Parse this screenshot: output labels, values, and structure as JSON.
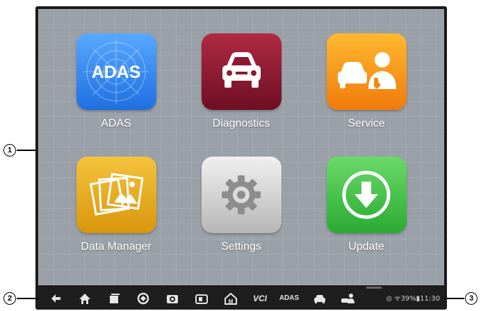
{
  "apps": [
    {
      "label": "ADAS",
      "icon": "adas-icon",
      "color_top": "#57a9ff",
      "color_bottom": "#1f6fe0",
      "badge": "ADAS"
    },
    {
      "label": "Diagnostics",
      "icon": "car-icon",
      "color_top": "#b12a43",
      "color_bottom": "#6d0f22"
    },
    {
      "label": "Service",
      "icon": "service-technician-icon",
      "color_top": "#ffb92f",
      "color_bottom": "#f07a0b"
    },
    {
      "label": "Data Manager",
      "icon": "photo-folder-icon",
      "color_top": "#f4c33d",
      "color_bottom": "#d9960b"
    },
    {
      "label": "Settings",
      "icon": "gear-icon",
      "color_top": "#f0f0f0",
      "color_bottom": "#b7b7b7"
    },
    {
      "label": "Update",
      "icon": "download-icon",
      "color_top": "#6bd968",
      "color_bottom": "#2aab32"
    }
  ],
  "page_indicator": {
    "count": 3,
    "active": 0
  },
  "taskbar": {
    "items": [
      "back-icon",
      "home-icon",
      "recent-apps-icon",
      "browser-icon",
      "camera-icon",
      "screenshot-icon",
      "home-dashboard-icon",
      "vci-icon",
      "adas-shortcut-icon",
      "car-shortcut-icon",
      "service-shortcut-icon"
    ],
    "vci_label": "VCI",
    "adas_label": "ADAS",
    "status": "◎ ᯤ39%▮11:30"
  },
  "callouts": {
    "one": "1",
    "two": "2",
    "three": "3"
  }
}
